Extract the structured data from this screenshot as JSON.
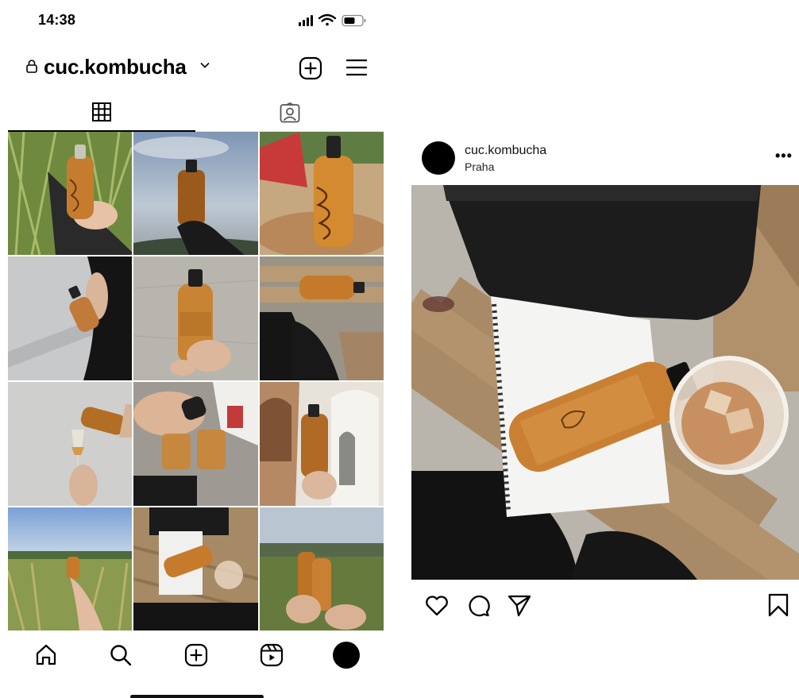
{
  "status_bar": {
    "time": "14:38"
  },
  "profile": {
    "username": "cuc.kombucha",
    "icons": [
      "lock-icon",
      "chevron-down-icon",
      "new-post-icon",
      "menu-icon"
    ]
  },
  "tabs": [
    {
      "name": "posts-grid",
      "icon": "grid-icon",
      "active": true
    },
    {
      "name": "tagged",
      "icon": "tagged-person-icon",
      "active": false
    }
  ],
  "grid": {
    "count": 12,
    "items": [
      "bottle-in-grass",
      "bottle-against-sky",
      "bottle-on-table",
      "bottle-held-wall",
      "bottle-held-concrete",
      "bottle-on-bench",
      "pouring-into-glass",
      "pouring-two-glasses",
      "bottle-archway",
      "bottle-field",
      "bottle-notebook-table",
      "two-bottles-field"
    ]
  },
  "bottom_nav": [
    "home-icon",
    "search-icon",
    "create-icon",
    "reels-icon",
    "profile-avatar"
  ],
  "post": {
    "username": "cuc.kombucha",
    "location": "Praha",
    "more_label": "•••",
    "actions": [
      "like-icon",
      "comment-icon",
      "share-icon",
      "save-icon"
    ]
  },
  "colors": {
    "accent": "#000000",
    "amber": "#c77a2a",
    "divider": "#e6e6e6"
  }
}
